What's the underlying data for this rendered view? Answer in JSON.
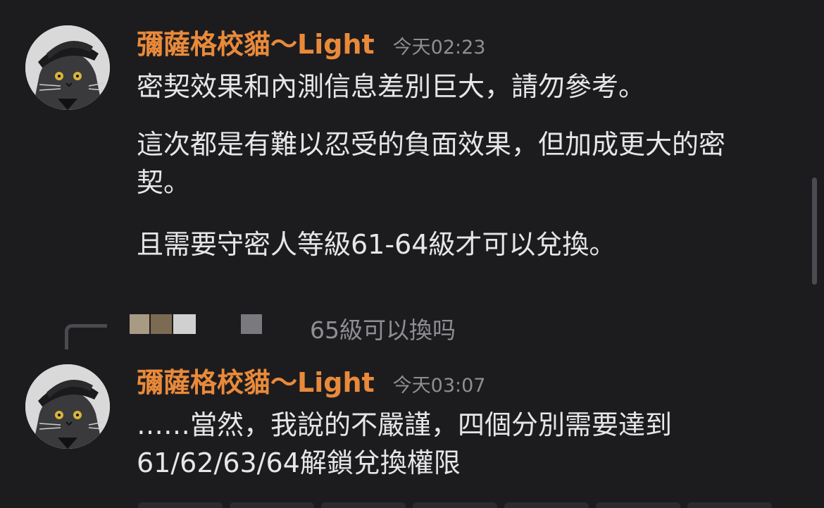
{
  "messages": [
    {
      "author": "彌薩格校貓～Light",
      "timestamp": "今天02:23",
      "paragraphs": [
        "密契效果和內測信息差別巨大，請勿參考。",
        "這次都是有難以忍受的負面效果，但加成更大的密契。",
        "且需要守密人等級61-64級才可以兌換。"
      ]
    },
    {
      "author": "彌薩格校貓～Light",
      "timestamp": "今天03:07",
      "paragraphs": [
        "……當然，我說的不嚴謹，四個分別需要達到61/62/63/64解鎖兌換權限"
      ]
    }
  ],
  "reply_preview": {
    "text": "65級可以換吗"
  },
  "colors": {
    "background": "#1c1c1f",
    "author": "#e98a3a",
    "timestamp": "#8e8e93",
    "text": "#e6e6e8"
  },
  "icons": {
    "avatar": "cat-avatar-icon",
    "reply": "reply-connector-icon"
  }
}
